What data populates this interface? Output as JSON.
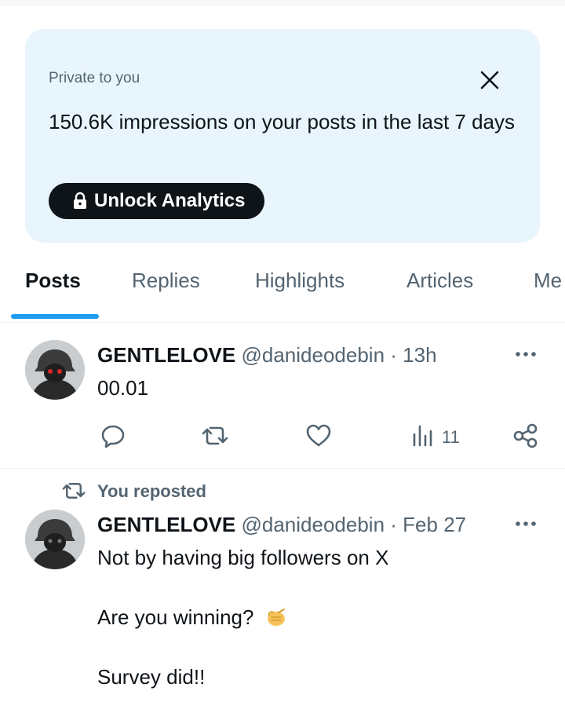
{
  "analytics_card": {
    "private_label": "Private to you",
    "headline": "150.6K impressions on your posts in the last 7 days",
    "unlock_label": "Unlock Analytics"
  },
  "tabs": [
    {
      "label": "Posts",
      "active": true
    },
    {
      "label": "Replies",
      "active": false
    },
    {
      "label": "Highlights",
      "active": false
    },
    {
      "label": "Articles",
      "active": false
    },
    {
      "label": "Me",
      "active": false
    }
  ],
  "posts": [
    {
      "name": "GENTLELOVE",
      "handle": "@danideodebin",
      "separator": "·",
      "time": "13h",
      "text": "00.01",
      "views": "11"
    },
    {
      "repost_label": "You reposted",
      "name": "GENTLELOVE",
      "handle": "@danideodebin",
      "separator": "·",
      "time": "Feb 27",
      "lines": [
        "Not by having big followers on X",
        "Are you winning?",
        "Survey did!!"
      ]
    }
  ],
  "colors": {
    "accent": "#1d9bf0",
    "card_bg": "#e8f5fd",
    "text_primary": "#0f1419",
    "text_secondary": "#536471"
  }
}
